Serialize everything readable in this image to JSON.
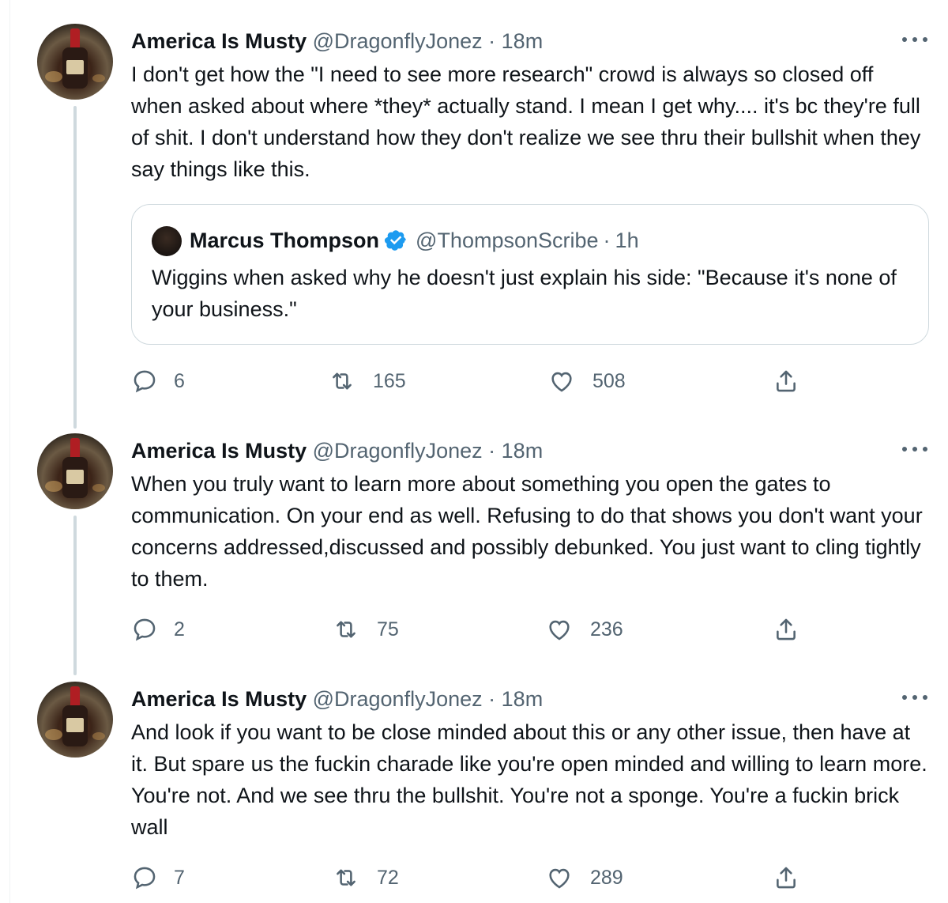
{
  "tweets": [
    {
      "name": "America Is Musty",
      "handle": "@DragonflyJonez",
      "separator": "·",
      "time": "18m",
      "text": "I don't get how the \"I need to see more research\" crowd is always so closed off when asked about where *they* actually stand. I mean I get why.... it's bc they're full of shit. I don't understand how they don't realize we see thru their bullshit when they say things like this.",
      "replies": "6",
      "retweets": "165",
      "likes": "508"
    },
    {
      "name": "America Is Musty",
      "handle": "@DragonflyJonez",
      "separator": "·",
      "time": "18m",
      "text": "When you truly want to learn more about something you open the gates to communication. On your end as well. Refusing to do that shows you don't want your concerns addressed,discussed and possibly debunked. You just want to cling tightly to them.",
      "replies": "2",
      "retweets": "75",
      "likes": "236"
    },
    {
      "name": "America Is Musty",
      "handle": "@DragonflyJonez",
      "separator": "·",
      "time": "18m",
      "text": "And look if you want to be close minded about this or any other issue, then have at it. But spare us the fuckin charade like you're open minded and willing to learn more. You're not. And we see thru the bullshit. You're not a sponge. You're a fuckin brick wall",
      "replies": "7",
      "retweets": "72",
      "likes": "289"
    }
  ],
  "quoted_tweet": {
    "name": "Marcus Thompson",
    "handle": "@ThompsonScribe",
    "separator": "·",
    "time": "1h",
    "verified": true,
    "text": "Wiggins when asked why he doesn't just explain his side: \"Because it's none of your business.\""
  },
  "icons": {
    "more": "more-dots-icon",
    "reply": "reply-icon",
    "retweet": "retweet-icon",
    "like": "heart-icon",
    "share": "share-icon",
    "verified": "verified-badge-icon"
  },
  "colors": {
    "text": "#0f1419",
    "secondary": "#536471",
    "border": "#cfd9de",
    "verified": "#1d9bf0"
  }
}
